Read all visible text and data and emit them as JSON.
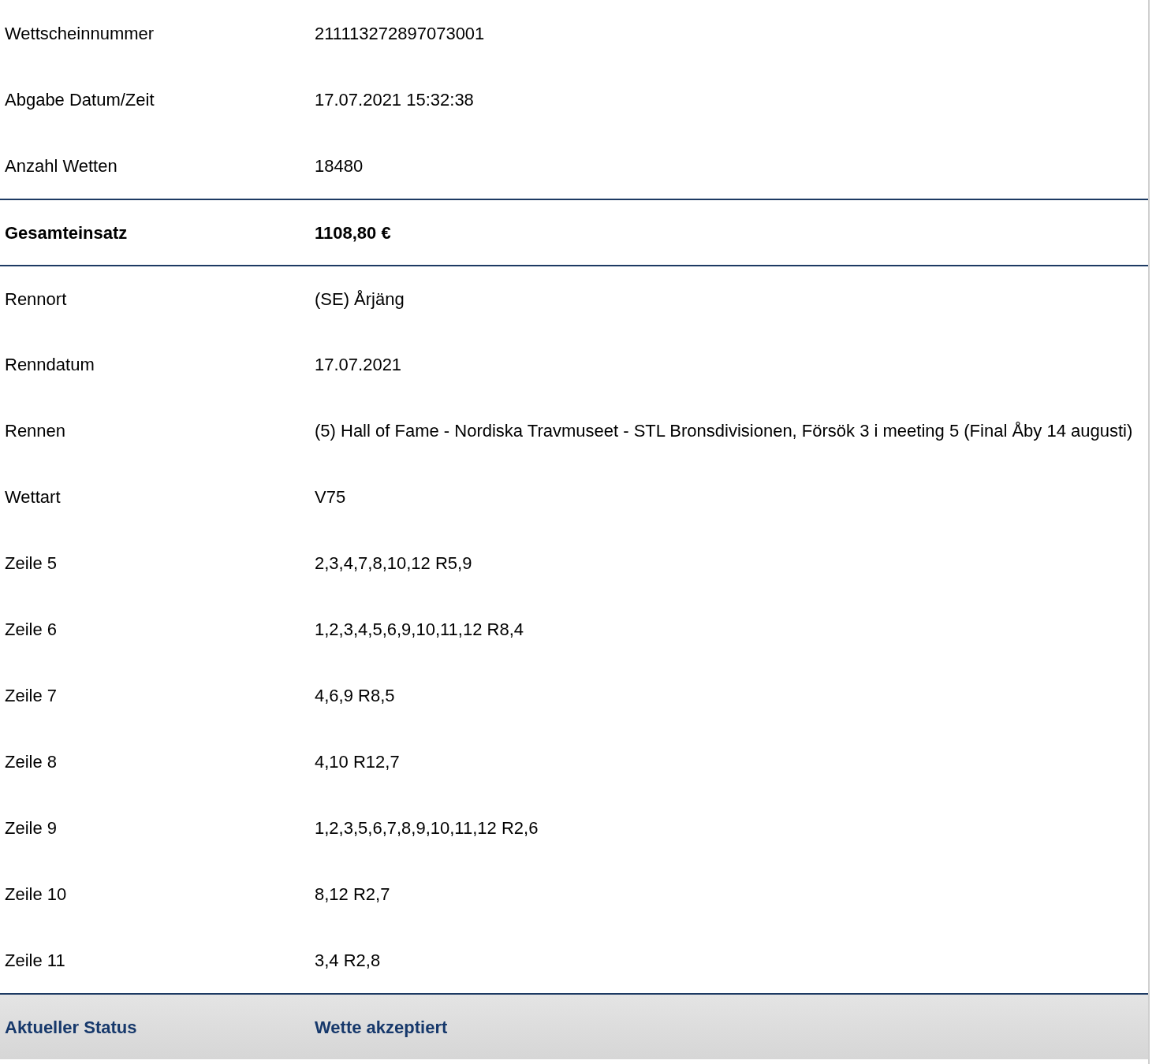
{
  "rows": [
    {
      "kind": "plain",
      "label": "Wettscheinnummer",
      "value": "211113272897073001"
    },
    {
      "kind": "plain",
      "label": "Abgabe Datum/Zeit",
      "value": "17.07.2021 15:32:38"
    },
    {
      "kind": "plain",
      "label": "Anzahl Wetten",
      "value": "18480"
    },
    {
      "kind": "total",
      "label": "Gesamteinsatz",
      "value": "1108,80 €"
    },
    {
      "kind": "plain",
      "label": "Rennort",
      "value": "(SE) Årjäng"
    },
    {
      "kind": "plain",
      "label": "Renndatum",
      "value": "17.07.2021"
    },
    {
      "kind": "plain",
      "label": "Rennen",
      "value": "(5) Hall of Fame - Nordiska Travmuseet - STL Bronsdivisionen, Försök 3 i meeting 5 (Final Åby 14 augusti)"
    },
    {
      "kind": "plain",
      "label": "Wettart",
      "value": "V75"
    },
    {
      "kind": "plain",
      "label": "Zeile 5",
      "value": "2,3,4,7,8,10,12 R5,9"
    },
    {
      "kind": "plain",
      "label": "Zeile 6",
      "value": "1,2,3,4,5,6,9,10,11,12 R8,4"
    },
    {
      "kind": "plain",
      "label": "Zeile 7",
      "value": "4,6,9 R8,5"
    },
    {
      "kind": "plain",
      "label": "Zeile 8",
      "value": "4,10 R12,7"
    },
    {
      "kind": "plain",
      "label": "Zeile 9",
      "value": "1,2,3,5,6,7,8,9,10,11,12 R2,6"
    },
    {
      "kind": "plain",
      "label": "Zeile 10",
      "value": "8,12 R2,7"
    },
    {
      "kind": "plain",
      "label": "Zeile 11",
      "value": "3,4 R2,8"
    },
    {
      "kind": "status",
      "label": "Aktueller Status",
      "value": "Wette akzeptiert"
    }
  ]
}
